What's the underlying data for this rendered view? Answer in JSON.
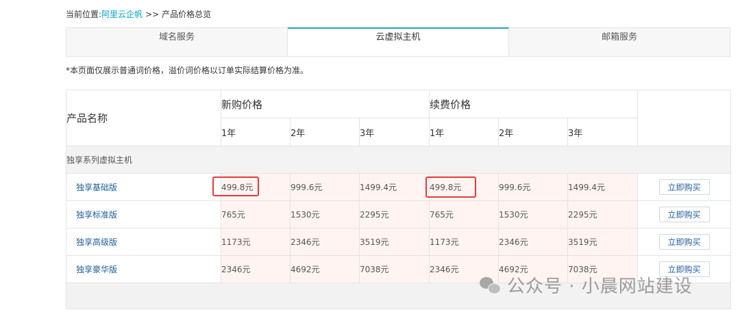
{
  "breadcrumb": {
    "prefix": "当前位置:",
    "home": "阿里云企帆",
    "sep": ">>",
    "current": "产品价格总览"
  },
  "tabs": [
    {
      "label": "域名服务",
      "active": false
    },
    {
      "label": "云虚拟主机",
      "active": true
    },
    {
      "label": "邮箱服务",
      "active": false
    }
  ],
  "note": "*本页面仅展示普通词价格，溢价词价格以订单实际结算价格为准。",
  "table": {
    "col_product": "产品名称",
    "group_new": "新购价格",
    "group_renew": "续费价格",
    "years": [
      "1年",
      "2年",
      "3年"
    ],
    "category": "独享系列虚拟主机",
    "buy_label": "立即购买",
    "rows": [
      {
        "name": "独享基础版",
        "new": [
          "499.8元",
          "999.6元",
          "1499.4元"
        ],
        "renew": [
          "499.8元",
          "999.6元",
          "1499.4元"
        ]
      },
      {
        "name": "独享标准版",
        "new": [
          "765元",
          "1530元",
          "2295元"
        ],
        "renew": [
          "765元",
          "1530元",
          "2295元"
        ]
      },
      {
        "name": "独享高级版",
        "new": [
          "1173元",
          "2346元",
          "3519元"
        ],
        "renew": [
          "1173元",
          "2346元",
          "3519元"
        ]
      },
      {
        "name": "独享豪华版",
        "new": [
          "2346元",
          "4692元",
          "7038元"
        ],
        "renew": [
          "2346元",
          "4692元",
          "7038元"
        ]
      }
    ]
  },
  "watermark": {
    "text": "公众号 · 小晨网站建设",
    "icon": "wechat-icon"
  },
  "colors": {
    "accent_tab": "#21a5b3",
    "link": "#1f5b9a",
    "highlight": "#e53a3a",
    "price_bg": "#fff4f1"
  }
}
